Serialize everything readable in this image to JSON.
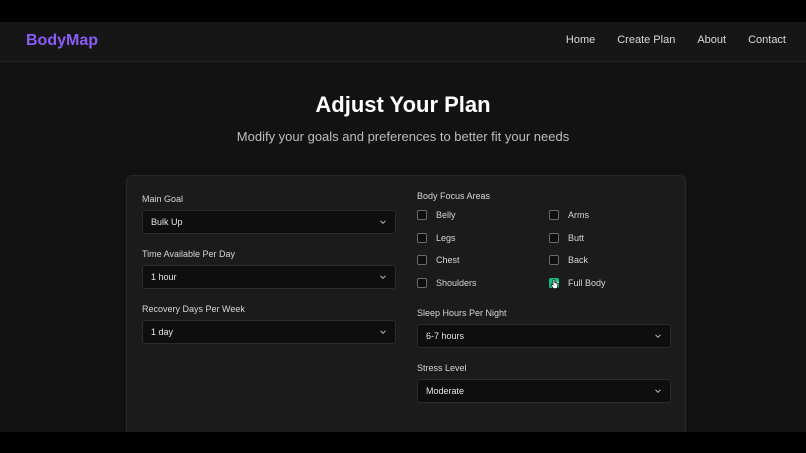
{
  "brand": {
    "name": "BodyMap",
    "color": "#8b5cf6"
  },
  "nav": {
    "items": [
      {
        "label": "Home"
      },
      {
        "label": "Create Plan"
      },
      {
        "label": "About"
      },
      {
        "label": "Contact"
      }
    ]
  },
  "hero": {
    "title": "Adjust Your Plan",
    "subtitle": "Modify your goals and preferences to better fit your needs"
  },
  "form": {
    "main_goal": {
      "label": "Main Goal",
      "value": "Bulk Up"
    },
    "time_per_day": {
      "label": "Time Available Per Day",
      "value": "1 hour"
    },
    "recovery_days": {
      "label": "Recovery Days Per Week",
      "value": "1 day"
    },
    "focus_areas": {
      "label": "Body Focus Areas",
      "options": [
        {
          "label": "Belly",
          "checked": false
        },
        {
          "label": "Arms",
          "checked": false
        },
        {
          "label": "Legs",
          "checked": false
        },
        {
          "label": "Butt",
          "checked": false
        },
        {
          "label": "Chest",
          "checked": false
        },
        {
          "label": "Back",
          "checked": false
        },
        {
          "label": "Shoulders",
          "checked": false
        },
        {
          "label": "Full Body",
          "checked": true
        }
      ]
    },
    "sleep_hours": {
      "label": "Sleep Hours Per Night",
      "value": "6-7 hours"
    },
    "stress_level": {
      "label": "Stress Level",
      "value": "Moderate"
    }
  },
  "colors": {
    "accent": "#8b5cf6",
    "checkbox_checked": "#10c08a",
    "background": "#121212"
  }
}
